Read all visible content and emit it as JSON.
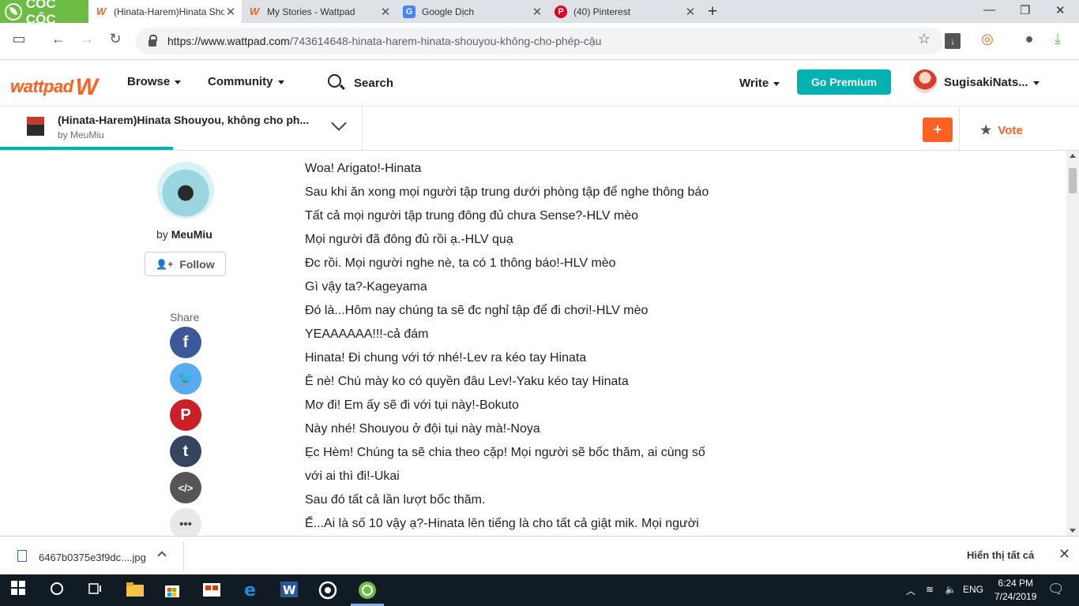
{
  "browser": {
    "brand": "CỐC CỐC",
    "tabs": [
      {
        "title": "(Hinata-Harem)Hinata Sho",
        "icon": "wattpad-icon",
        "active": true
      },
      {
        "title": "My Stories - Wattpad",
        "icon": "wattpad-icon",
        "active": false
      },
      {
        "title": "Google Dịch",
        "icon": "google-translate-icon",
        "active": false
      },
      {
        "title": "(40) Pinterest",
        "icon": "pinterest-icon",
        "active": false
      }
    ],
    "url_host": "https://www.wattpad.com",
    "url_path": "/743614648-hinata-harem-hinata-shouyou-không-cho-phép-cậu"
  },
  "header": {
    "logo": "wattpad",
    "nav": {
      "browse": "Browse",
      "community": "Community",
      "search": "Search",
      "write": "Write"
    },
    "premium": "Go Premium",
    "username": "SugisakiNats..."
  },
  "storybar": {
    "title": "(Hinata-Harem)Hinata Shouyou, không cho ph...",
    "by": "by MeuMiu",
    "add_label": "+",
    "vote_label": "Vote",
    "reading_progress": 0.16
  },
  "author": {
    "by_prefix": "by",
    "name": "MeuMiu",
    "follow": "Follow"
  },
  "share": {
    "label": "Share",
    "buttons": [
      {
        "name": "facebook",
        "glyph": "f",
        "color": "#3b5998"
      },
      {
        "name": "twitter",
        "glyph": "🐦",
        "color": "#55acee"
      },
      {
        "name": "pinterest",
        "glyph": "P",
        "color": "#cb2027"
      },
      {
        "name": "tumblr",
        "glyph": "t",
        "color": "#34465d"
      },
      {
        "name": "embed",
        "glyph": "</>",
        "color": "#555555"
      },
      {
        "name": "more",
        "glyph": "•••",
        "color": "#e8e8e8"
      }
    ]
  },
  "story_lines": [
    "Woa! Arigato!-Hinata",
    "Sau khi ăn xong mọi người tập trung dưới phòng tập để nghe thông báo",
    "Tất cả mọi người tập trung đông đủ chưa Sense?-HLV mèo",
    "Mọi người đã đông đủ rồi ạ.-HLV quạ",
    "Đc rồi. Mọi người nghe nè, ta có 1 thông báo!-HLV mèo",
    "Gì vậy ta?-Kageyama",
    "Đó là...Hôm nay chúng ta sẽ đc nghỉ tập để đi chơi!-HLV mèo",
    "YEAAAAAA!!!-cả đám",
    "Hinata! Đi chung với tớ nhé!-Lev ra kéo tay Hinata",
    "Ê nè! Chú mày ko có quyền đâu Lev!-Yaku kéo tay Hinata",
    "Mơ đi! Em ấy sẽ đi với tụi này!-Bokuto",
    "Này nhé! Shouyou ở đội tụi này mà!-Noya",
    "Ẹc Hèm! Chúng ta sẽ chia theo cặp! Mọi người sẽ bốc thăm, ai cùng số",
    "với ai thì đi!-Ukai",
    "Sau đó tất cả lần lượt bốc thăm.",
    "Ế...Ai là số 10 vậy ạ?-Hinata lên tiếng là cho tất cả giật mik. Mọi người"
  ],
  "download": {
    "file": "6467b0375e3f9dc....jpg",
    "show_all": "Hiển thị tất cả"
  },
  "taskbar": {
    "lang": "ENG",
    "time": "6:24 PM",
    "date": "7/24/2019"
  }
}
